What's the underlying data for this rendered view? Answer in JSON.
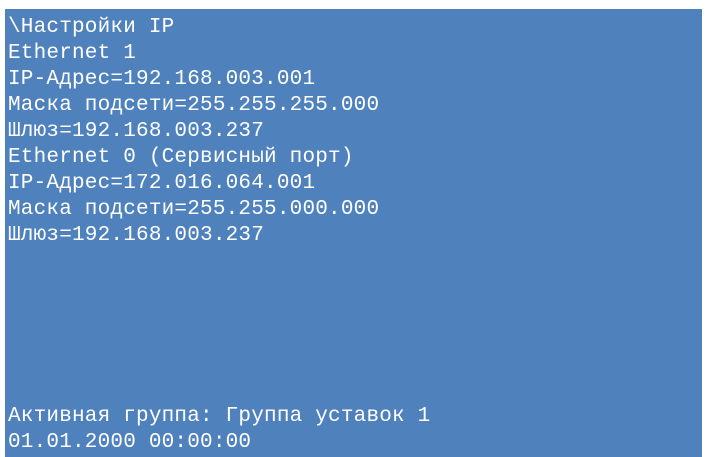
{
  "screen": {
    "background_color": "#4f81bd",
    "text_color": "#ffffff",
    "title": "\\Настройки IP",
    "ethernet1": {
      "header": "Ethernet 1",
      "ip": "IP-Адрес=192.168.003.001",
      "mask": "Маска подсети=255.255.255.000",
      "gateway": "Шлюз=192.168.003.237"
    },
    "ethernet0": {
      "header": "Ethernet 0 (Сервисный порт)",
      "ip": "IP-Адрес=172.016.064.001",
      "mask": "Маска подсети=255.255.000.000",
      "gateway": "Шлюз=192.168.003.237"
    },
    "status": {
      "active_group": "Активная группа: Группа уставок 1",
      "datetime": "01.01.2000 00:00:00"
    }
  }
}
